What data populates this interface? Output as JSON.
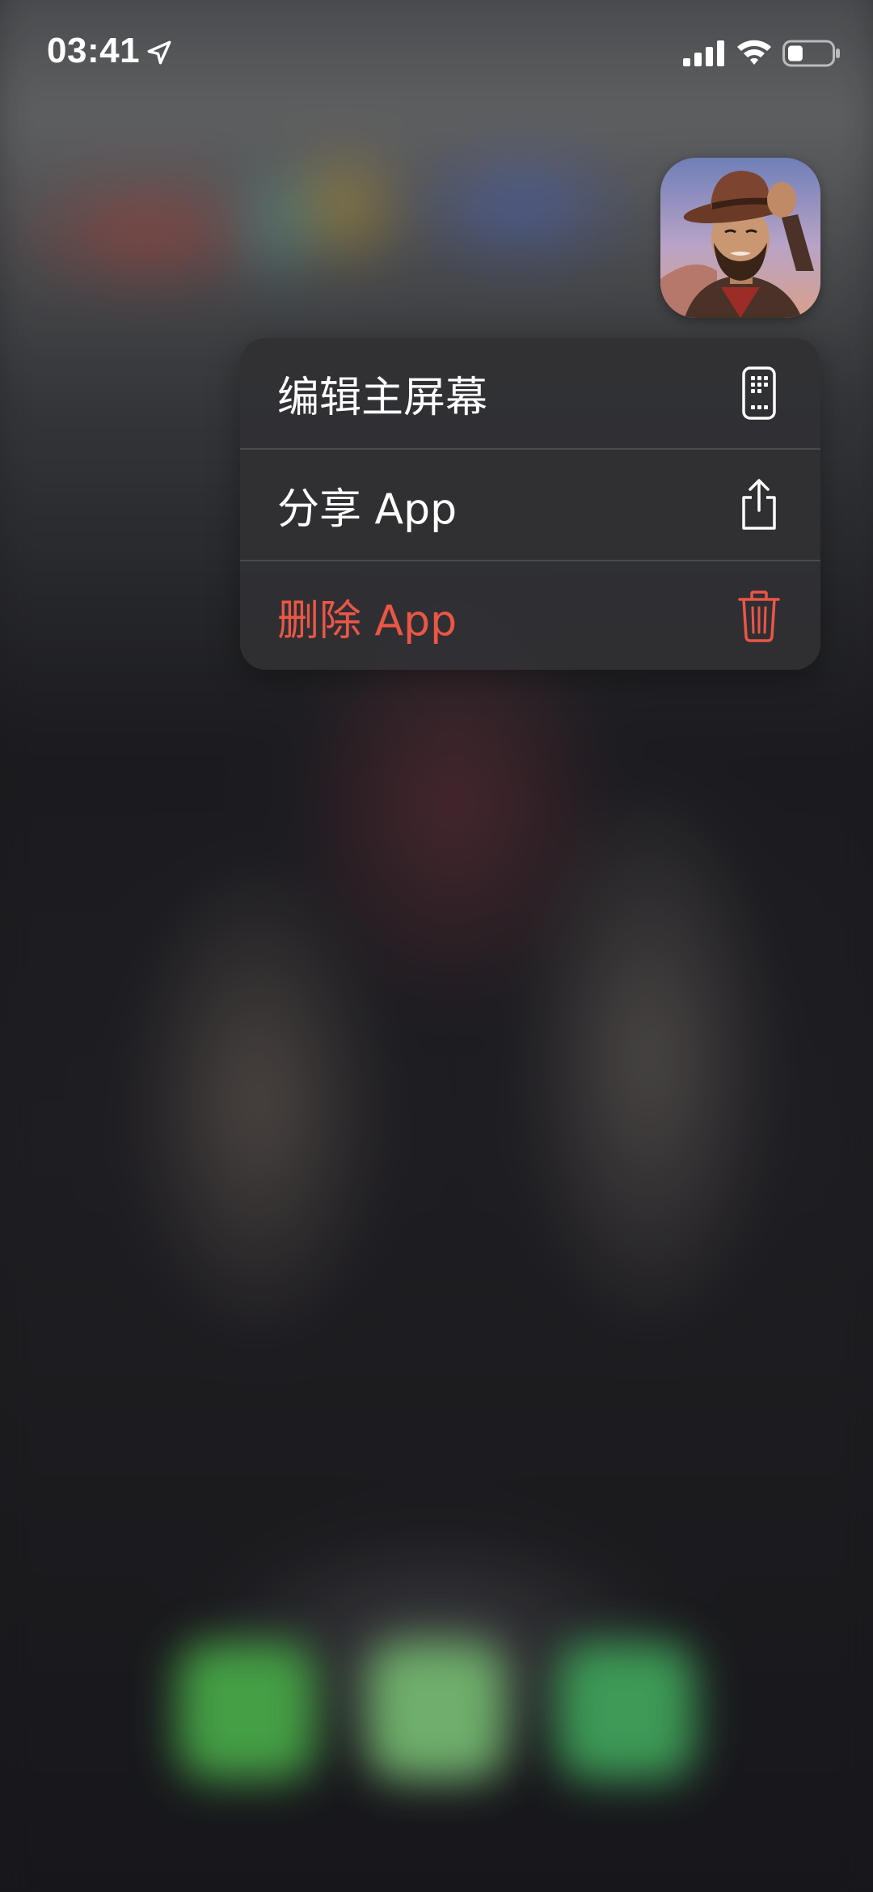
{
  "status_bar": {
    "time": "03:41",
    "icons": [
      "location-arrow-icon",
      "cellular-signal-icon",
      "wifi-icon",
      "battery-icon"
    ],
    "battery_level": 0.35
  },
  "app": {
    "icon_name": "cowboy-game-app-icon"
  },
  "context_menu": {
    "items": [
      {
        "label": "编辑主屏幕",
        "icon": "edit-home-screen-icon",
        "destructive": false
      },
      {
        "label": "分享 App",
        "icon": "share-icon",
        "destructive": false
      },
      {
        "label": "删除 App",
        "icon": "trash-icon",
        "destructive": true
      }
    ]
  },
  "dock": {
    "apps": [
      "phone-app-icon",
      "messages-app-icon",
      "facetime-app-icon"
    ]
  },
  "colors": {
    "destructive": "#eb5645",
    "menu_background": "#303034",
    "text": "#ffffff"
  }
}
